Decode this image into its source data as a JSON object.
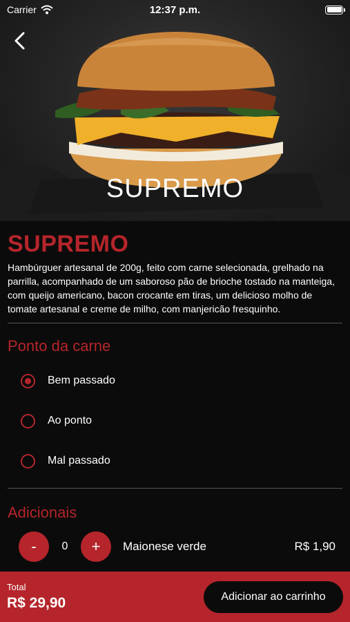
{
  "status_bar": {
    "carrier": "Carrier",
    "time": "12:37 p.m."
  },
  "hero": {
    "title": "SUPREMO"
  },
  "product": {
    "name": "SUPREMO",
    "description": "Hambúrguer artesanal de 200g, feito com carne selecionada, grelhado na parrilla, acompanhado de um saboroso pão de brioche tostado na manteiga, com queijo americano, bacon crocante em tiras, um delicioso molho de tomate artesanal e creme de milho, com manjericão fresquinho."
  },
  "meat_point": {
    "title": "Ponto da carne",
    "options": [
      {
        "label": "Bem passado",
        "selected": true
      },
      {
        "label": "Ao ponto",
        "selected": false
      },
      {
        "label": "Mal passado",
        "selected": false
      }
    ]
  },
  "addons": {
    "title": "Adicionais",
    "items": [
      {
        "minus": "-",
        "quantity": "0",
        "plus": "+",
        "name": "Maionese verde",
        "price": "R$ 1,90"
      }
    ]
  },
  "footer": {
    "total_label": "Total",
    "total_value": "R$ 29,90",
    "add_to_cart": "Adicionar ao carrinho"
  },
  "colors": {
    "accent": "#b5252b",
    "background": "#0b0b0b",
    "button_dark": "#0b0b0b"
  }
}
